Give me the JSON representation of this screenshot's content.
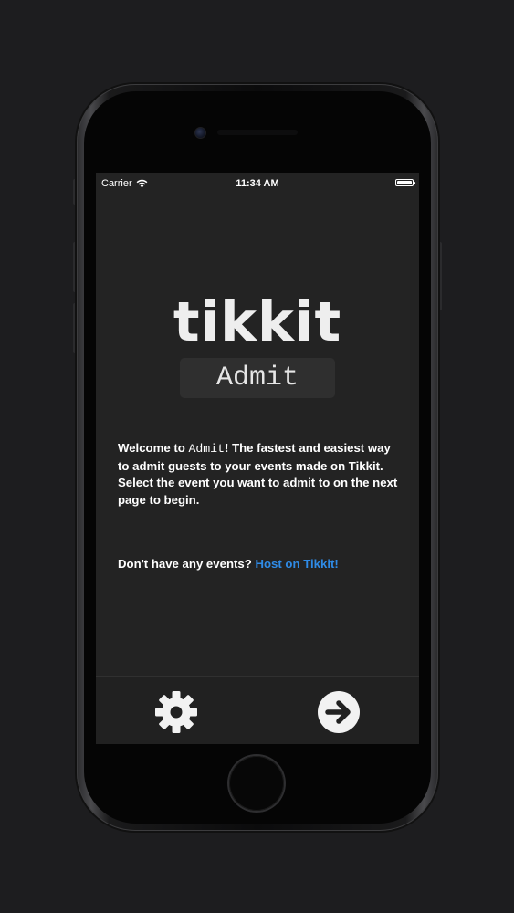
{
  "status_bar": {
    "carrier": "Carrier",
    "time": "11:34 AM",
    "wifi_icon": "wifi-icon",
    "battery_icon": "battery-icon"
  },
  "app": {
    "logo": "tikkit",
    "badge": "Admit"
  },
  "welcome": {
    "part1": "Welcome to ",
    "app_name": "Admit",
    "part2": "! The fastest and easiest way to admit guests to your events made on Tikkit. Select the event you want to admit to on the next page to begin."
  },
  "no_events": {
    "prompt": "Don't have any events? ",
    "link": "Host on Tikkit!"
  },
  "tabbar": {
    "settings_icon": "gear-icon",
    "next_icon": "arrow-right-circle-icon"
  },
  "colors": {
    "screen_bg": "#232323",
    "link": "#2f8be6",
    "text": "#ffffff"
  }
}
